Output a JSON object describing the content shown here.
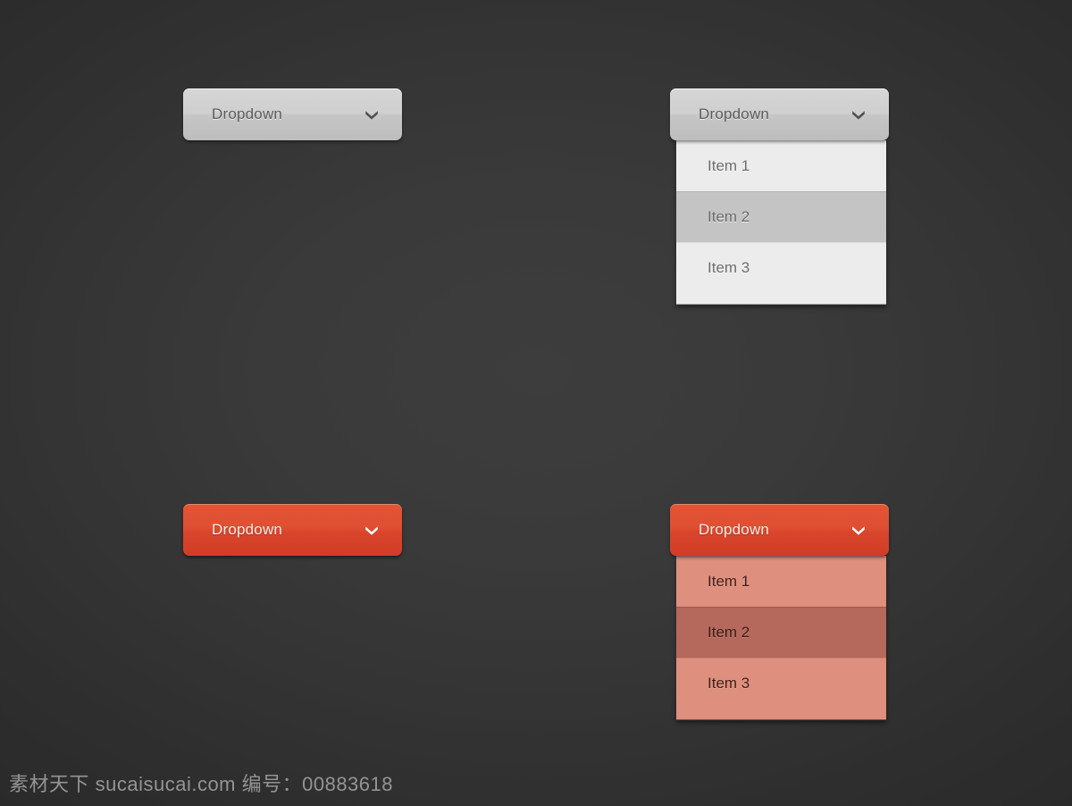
{
  "page": {
    "background_color": "#353535",
    "watermark": "素材天下 sucaisucai.com  编号：00883618"
  },
  "icons": {
    "chevron_down": "chevron-down-icon"
  },
  "theme_colors": {
    "gray_button_top": "#d6d6d6",
    "gray_button_bottom": "#bdbdbd",
    "gray_menu_bg": "#ececec",
    "gray_menu_active": "#c4c4c4",
    "gray_label": "#5c5c5c",
    "red_button_top": "#e35535",
    "red_button_bottom": "#d23c27",
    "red_menu_bg": "#de8f7e",
    "red_menu_active": "#b5685c",
    "red_label": "#fdeeea"
  },
  "dropdowns": [
    {
      "id": "gray-closed",
      "variant": "gray",
      "state": "closed",
      "label": "Dropdown",
      "items": []
    },
    {
      "id": "gray-open",
      "variant": "gray",
      "state": "open",
      "label": "Dropdown",
      "items": [
        {
          "label": "Item 1",
          "active": false
        },
        {
          "label": "Item 2",
          "active": true
        },
        {
          "label": "Item 3",
          "active": false
        }
      ]
    },
    {
      "id": "red-closed",
      "variant": "red",
      "state": "closed",
      "label": "Dropdown",
      "items": []
    },
    {
      "id": "red-open",
      "variant": "red",
      "state": "open",
      "label": "Dropdown",
      "items": [
        {
          "label": "Item 1",
          "active": false
        },
        {
          "label": "Item 2",
          "active": true
        },
        {
          "label": "Item 3",
          "active": false
        }
      ]
    }
  ]
}
